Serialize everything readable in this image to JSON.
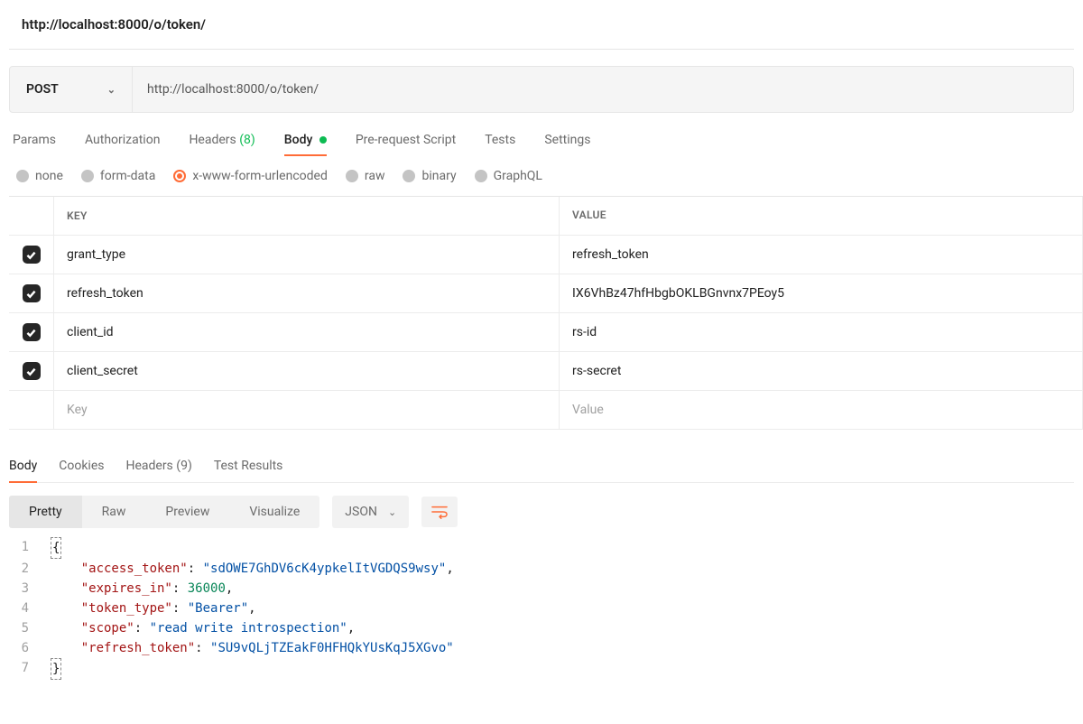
{
  "breadcrumb": "http://localhost:8000/o/token/",
  "method": "POST",
  "url": "http://localhost:8000/o/token/",
  "request_tabs": {
    "params": "Params",
    "auth": "Authorization",
    "headers_label": "Headers",
    "headers_count": "(8)",
    "body": "Body",
    "prerequest": "Pre-request Script",
    "tests": "Tests",
    "settings": "Settings"
  },
  "body_types": {
    "none": "none",
    "formdata": "form-data",
    "urlencoded": "x-www-form-urlencoded",
    "raw": "raw",
    "binary": "binary",
    "graphql": "GraphQL"
  },
  "kv_header": {
    "key": "KEY",
    "value": "VALUE"
  },
  "kv": [
    {
      "k": "grant_type",
      "v": "refresh_token"
    },
    {
      "k": "refresh_token",
      "v": "IX6VhBz47hfHbgbOKLBGnvnx7PEoy5"
    },
    {
      "k": "client_id",
      "v": "rs-id"
    },
    {
      "k": "client_secret",
      "v": "rs-secret"
    }
  ],
  "kv_placeholder": {
    "key": "Key",
    "value": "Value"
  },
  "response_tabs": {
    "body": "Body",
    "cookies": "Cookies",
    "headers_label": "Headers",
    "headers_count": "(9)",
    "test_results": "Test Results"
  },
  "view_modes": {
    "pretty": "Pretty",
    "raw": "Raw",
    "preview": "Preview",
    "visualize": "Visualize"
  },
  "format_select": "JSON",
  "json_lines": [
    {
      "n": 1,
      "t": "brace_open",
      "text": "{"
    },
    {
      "n": 2,
      "t": "kv_str",
      "indent": "    ",
      "key": "\"access_token\"",
      "sep": ": ",
      "val": "\"sdOWE7GhDV6cK4ypkelItVGDQS9wsy\"",
      "comma": ","
    },
    {
      "n": 3,
      "t": "kv_num",
      "indent": "    ",
      "key": "\"expires_in\"",
      "sep": ": ",
      "val": "36000",
      "comma": ","
    },
    {
      "n": 4,
      "t": "kv_str",
      "indent": "    ",
      "key": "\"token_type\"",
      "sep": ": ",
      "val": "\"Bearer\"",
      "comma": ","
    },
    {
      "n": 5,
      "t": "kv_str",
      "indent": "    ",
      "key": "\"scope\"",
      "sep": ": ",
      "val": "\"read write introspection\"",
      "comma": ","
    },
    {
      "n": 6,
      "t": "kv_str",
      "indent": "    ",
      "key": "\"refresh_token\"",
      "sep": ": ",
      "val": "\"SU9vQLjTZEakF0HFHQkYUsKqJ5XGvo\"",
      "comma": ""
    },
    {
      "n": 7,
      "t": "brace_close",
      "text": "}"
    }
  ]
}
